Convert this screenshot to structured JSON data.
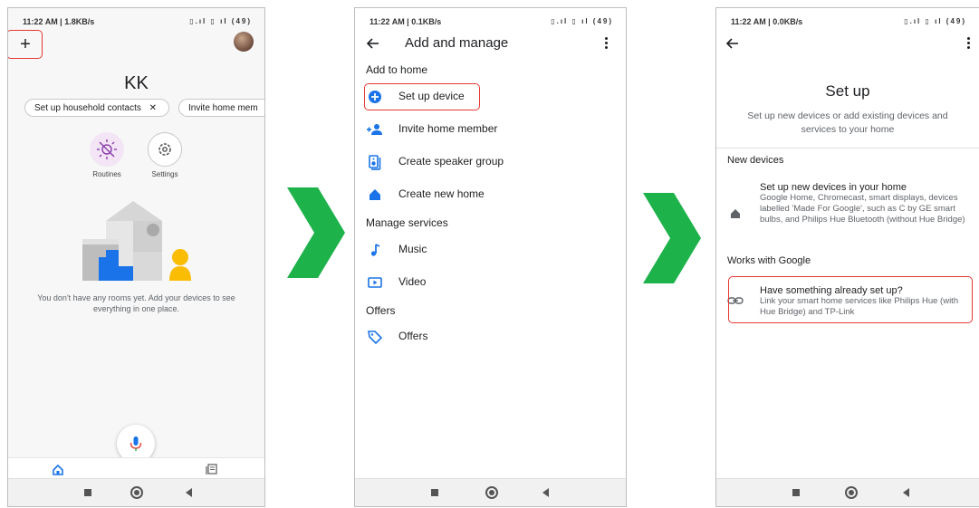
{
  "screen1": {
    "status_time": "11:22 AM | 1.8KB/s",
    "status_icons": "▯.ıl ▯ ıl (49)",
    "add_symbol": "+",
    "home_name": "KK",
    "chips": [
      "Set up household contacts",
      "Invite home mem"
    ],
    "chip_close": "✕",
    "routines_label": "Routines",
    "settings_label": "Settings",
    "empty_message": "You don't have any rooms yet. Add your devices to see everything in one place."
  },
  "screen2": {
    "status_time": "11:22 AM | 0.1KB/s",
    "status_icons": "▯.ıl ▯ ıl (49)",
    "title": "Add and manage",
    "section_add": "Add to home",
    "items_add": [
      "Set up device",
      "Invite home member",
      "Create speaker group",
      "Create new home"
    ],
    "section_manage": "Manage services",
    "items_manage": [
      "Music",
      "Video"
    ],
    "section_offers": "Offers",
    "items_offers": [
      "Offers"
    ]
  },
  "screen3": {
    "status_time": "11:22 AM | 0.0KB/s",
    "status_icons": "▯.ıl ▯ ıl (49)",
    "title": "Set up",
    "subtitle": "Set up new devices or add existing devices and services to your home",
    "section_new": "New devices",
    "new_title": "Set up new devices in your home",
    "new_desc": "Google Home, Chromecast, smart displays, devices labelled 'Made For Google', such as C by GE smart bulbs, and Philips Hue Bluetooth (without Hue Bridge)",
    "section_works": "Works with Google",
    "works_title": "Have something already set up?",
    "works_desc": "Link your smart home services like Philips Hue (with Hue Bridge) and TP-Link"
  },
  "colors": {
    "blue": "#1a73e8",
    "red_highlight": "#e53935",
    "arrow_green": "#1db24a",
    "routines_bg": "#f3e5f5",
    "yellow": "#fbbc04"
  }
}
